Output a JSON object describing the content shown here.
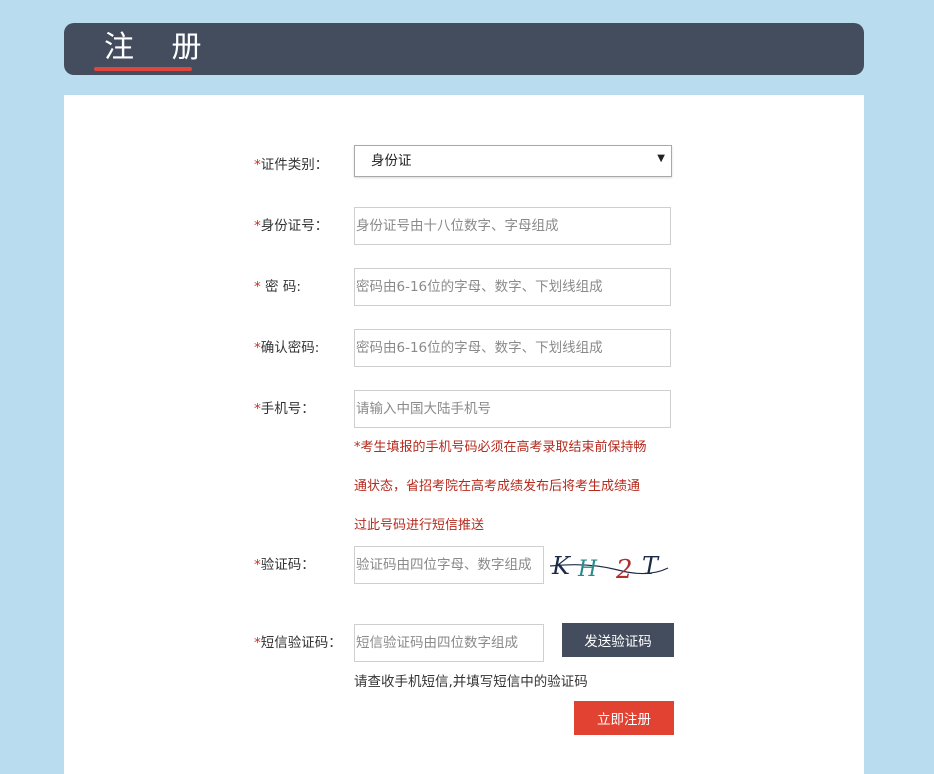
{
  "header": {
    "title": "注 册"
  },
  "form": {
    "id_type": {
      "star": "*",
      "label": "证件类别：",
      "selected": "身份证"
    },
    "id_number": {
      "star": "*",
      "label": "身份证号：",
      "placeholder": "身份证号由十八位数字、字母组成",
      "value": ""
    },
    "password": {
      "star": "*",
      "label": " 密 码:",
      "placeholder": "密码由6-16位的字母、数字、下划线组成",
      "value": ""
    },
    "confirm_password": {
      "star": "*",
      "label": "确认密码:",
      "placeholder": "密码由6-16位的字母、数字、下划线组成",
      "value": ""
    },
    "phone": {
      "star": "*",
      "label": "手机号：",
      "placeholder": "请输入中国大陆手机号",
      "value": "",
      "notice_lines": [
        "*考生填报的手机号码必须在高考录取结束前保持畅",
        "通状态，省招考院在高考成绩发布后将考生成绩通",
        "过此号码进行短信推送"
      ]
    },
    "captcha": {
      "star": "*",
      "label": "验证码：",
      "placeholder": "验证码由四位字母、数字组成",
      "value": "",
      "image_text": "KH2T"
    },
    "sms_code": {
      "star": "*",
      "label": "短信验证码：",
      "placeholder": "短信验证码由四位数字组成",
      "value": "",
      "send_button": "发送验证码",
      "hint": "请查收手机短信,并填写短信中的验证码"
    },
    "submit_button": "立即注册"
  },
  "colors": {
    "background": "#b9dcef",
    "header": "#444d5e",
    "accent": "#e0473a",
    "notice": "#b52a1d",
    "submit": "#e14232"
  }
}
